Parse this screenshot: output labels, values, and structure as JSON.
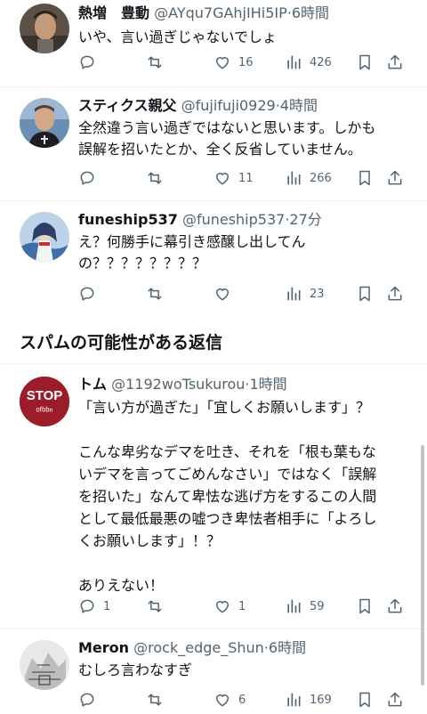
{
  "tweets": [
    {
      "name": "熱増　豊動",
      "handle": "@AYqu7GAhjIHi5IP",
      "sep": "·",
      "time": "6時間",
      "text": "いや、言い過ぎじゃないでしょ",
      "replies": "",
      "retweets": "",
      "likes": "16",
      "views": "426"
    },
    {
      "name": "スティクス親父",
      "handle": "@fujifuji0929",
      "sep": "·",
      "time": "4時間",
      "text": "全然違う言い過ぎではないと思います。しかも\n誤解を招いたとか、全く反省していません。",
      "replies": "",
      "retweets": "",
      "likes": "11",
      "views": "266"
    },
    {
      "name": "funeship537",
      "handle": "@funeship537",
      "sep": "·",
      "time": "27分",
      "text": "え？何勝手に幕引き感醸し出してん\nの？？？？？？？？",
      "replies": "",
      "retweets": "",
      "likes": "",
      "views": "23"
    },
    {
      "name": "トム",
      "handle": "@1192woTsukurou",
      "sep": "·",
      "time": "1時間",
      "text": "「言い方が過ぎた」「宜しくお願いします」？\n\nこんな卑劣なデマを吐き、それを「根も葉もな\nいデマを言ってごめんなさい」ではなく「誤解\nを招いた」なんて卑怯な逃げ方をするこの人間\nとして最低最悪の嘘つき卑怯者相手に「よろし\nくお願いします」！？\n\nありえない！",
      "replies": "1",
      "retweets": "",
      "likes": "1",
      "views": "59"
    },
    {
      "name": "Meron",
      "handle": "@rock_edge_Shun",
      "sep": "·",
      "time": "6時間",
      "text": "むしろ言わなすぎ",
      "replies": "",
      "retweets": "",
      "likes": "6",
      "views": "169"
    }
  ],
  "spam_section_title": "スパムの可能性がある返信",
  "avatar_stop": {
    "line1": "STOP",
    "line2": "ᵒᶠᵇᵇⁿ"
  },
  "colors": {
    "text": "#0f1419",
    "secondary": "#536471",
    "divider": "#eff3f4"
  }
}
